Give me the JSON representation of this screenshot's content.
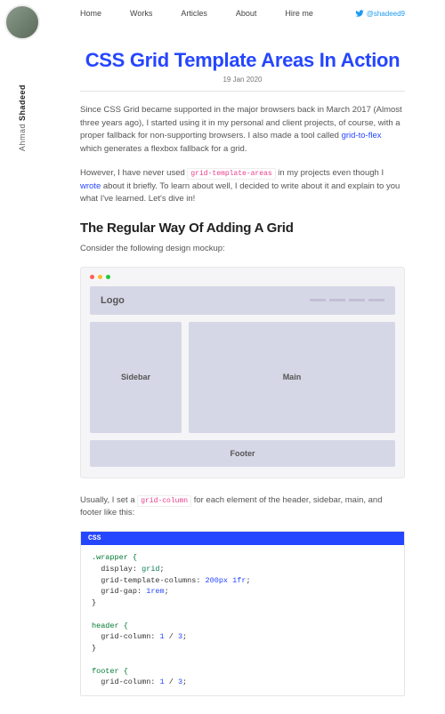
{
  "author": {
    "first": "Ahmad",
    "last": "Shadeed"
  },
  "nav": {
    "home": "Home",
    "works": "Works",
    "articles": "Articles",
    "about": "About",
    "hire": "Hire me"
  },
  "twitter": {
    "handle": "@shadeed9"
  },
  "post": {
    "title": "CSS Grid Template Areas In Action",
    "date": "19 Jan 2020",
    "p1a": "Since CSS Grid became supported in the major browsers back in March 2017 (Almost three years ago), I started using it in my personal and client projects, of course, with a proper fallback for non-supporting browsers. I also made a tool called ",
    "link1": "grid-to-flex",
    "p1b": " which generates a flexbox fallback for a grid.",
    "p2a": "However, I have never used ",
    "code1": "grid-template-areas",
    "p2b": " in my projects even though I ",
    "link2": "wrote",
    "p2c": " about it briefly. To learn about well, I decided to write about it and explain to you what I've learned. Let's dive in!",
    "h2": "The Regular Way Of Adding A Grid",
    "p3": "Consider the following design mockup:",
    "p4a": "Usually, I set a ",
    "code2": "grid-column",
    "p4b": " for each element of the header, sidebar, main, and footer like this:"
  },
  "mockup": {
    "logo": "Logo",
    "sidebar": "Sidebar",
    "main": "Main",
    "footer": "Footer"
  },
  "code": {
    "label": "CSS",
    "l1": ".wrapper {",
    "l2a": "display: ",
    "l2b": "grid",
    "l2c": ";",
    "l3a": "grid-template-columns: ",
    "l3b": "200px 1fr",
    "l3c": ";",
    "l4a": "grid-gap: ",
    "l4b": "1rem",
    "l4c": ";",
    "l5": "}",
    "l6": "header {",
    "l7a": "grid-column: ",
    "l7b": "1",
    "l7c": " / ",
    "l7d": "3",
    "l7e": ";",
    "l8": "}",
    "l9": "footer {",
    "l10a": "grid-column: ",
    "l10b": "1",
    "l10c": " / ",
    "l10d": "3",
    "l10e": ";"
  }
}
